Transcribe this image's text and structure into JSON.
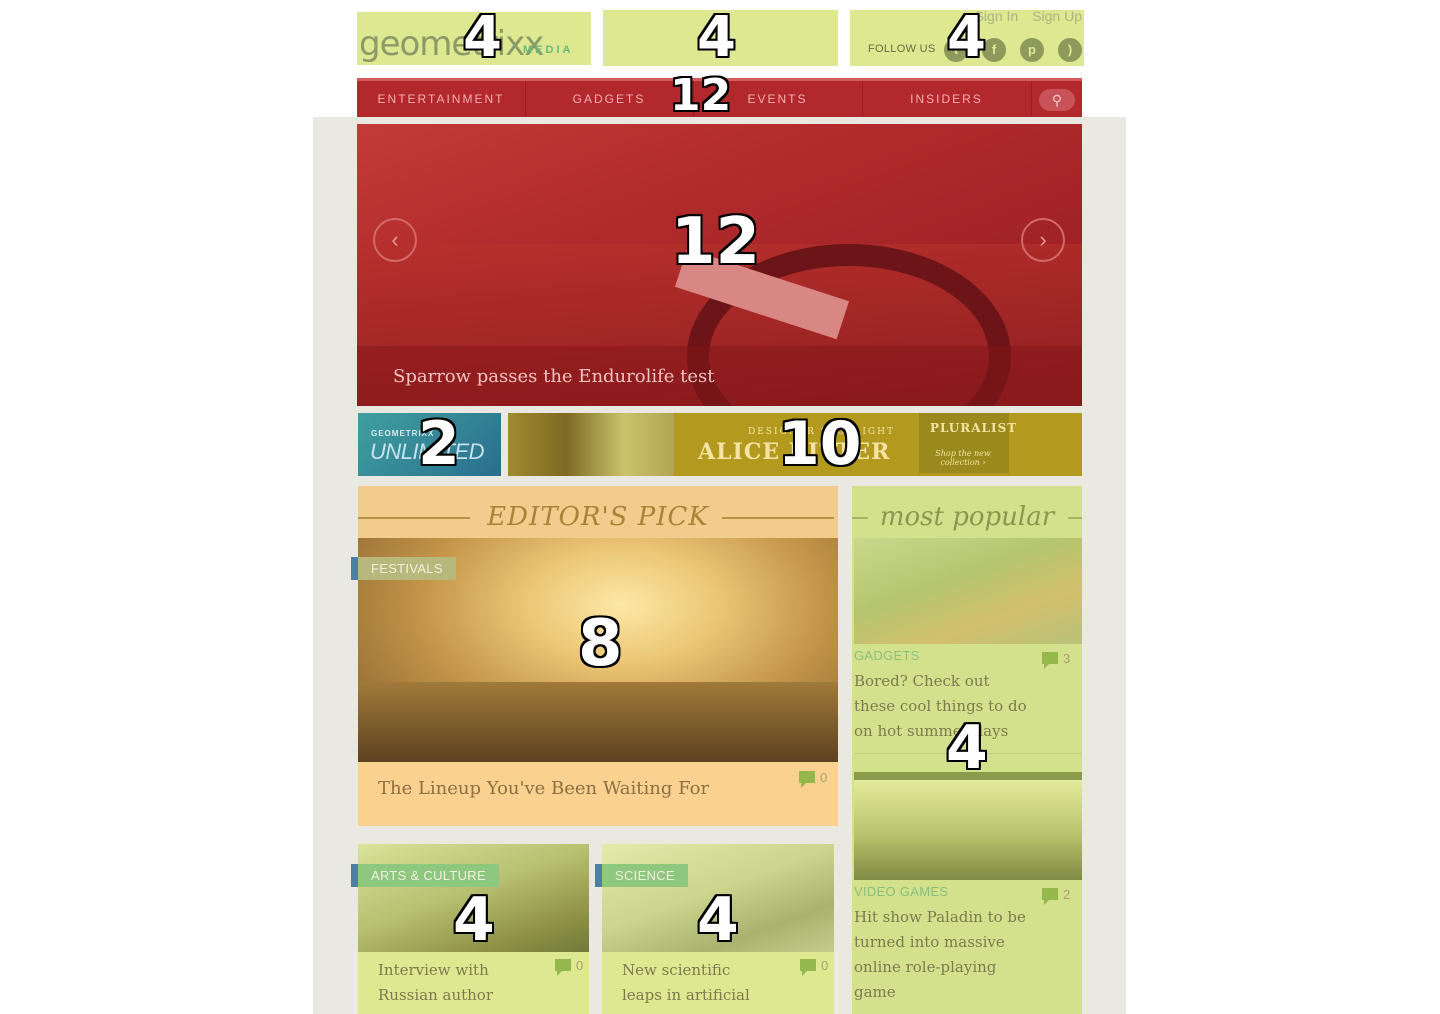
{
  "header": {
    "logo_text": "geometrixx",
    "logo_sub": "MEDIA",
    "sign_in": "Sign In",
    "sign_up": "Sign Up",
    "follow_us": "FOLLOW US",
    "social_icons": [
      "twitter-icon",
      "facebook-icon",
      "pinterest-icon",
      "rss-icon"
    ]
  },
  "nav": {
    "items": [
      "ENTERTAINMENT",
      "GADGETS",
      "EVENTS",
      "INSIDERS"
    ],
    "search_icon": "search-icon"
  },
  "hero": {
    "title": "Sparrow passes the Endurolife test",
    "prev": "‹",
    "next": "›"
  },
  "banners": {
    "left_kicker": "GEOMETRIXX",
    "left_title": "UNLIMITED",
    "right_kicker": "DESIGNER SPOTLIGHT",
    "right_name": "ALICE RITTER",
    "right_tag": "PLURALIST",
    "right_tagline": "Shop the new collection ›"
  },
  "editors_pick": {
    "heading": "EDITOR'S PICK",
    "tag": "FESTIVALS",
    "title": "The Lineup You've Been Waiting For",
    "comments": "0"
  },
  "most_popular": {
    "heading": "most popular",
    "items": [
      {
        "category": "GADGETS",
        "title": "Bored? Check out these cool things to do on hot summer days",
        "comments": "3"
      },
      {
        "category": "VIDEO GAMES",
        "title": "Hit show Paladin to be turned into massive online role-playing game",
        "comments": "2"
      }
    ]
  },
  "cards": [
    {
      "tag": "ARTS & CULTURE",
      "title": "Interview with Russian author Andrey Nov...",
      "comments": "0"
    },
    {
      "tag": "SCIENCE",
      "title": "New scientific leaps in artificial intelli...",
      "comments": "0"
    }
  ],
  "grid_overlay": {
    "header_logo": "4",
    "header_middle": "4",
    "header_social": "4",
    "nav": "12",
    "hero": "12",
    "banner_small": "2",
    "banner_large": "10",
    "editors_pick": "8",
    "most_popular": "4",
    "card_arts": "4",
    "card_science": "4"
  },
  "colors": {
    "nav_red": "#b3282d",
    "overlay_green": "#dde891",
    "overlay_orange": "#f1cc8c",
    "page_bg": "#e9e9e1"
  }
}
